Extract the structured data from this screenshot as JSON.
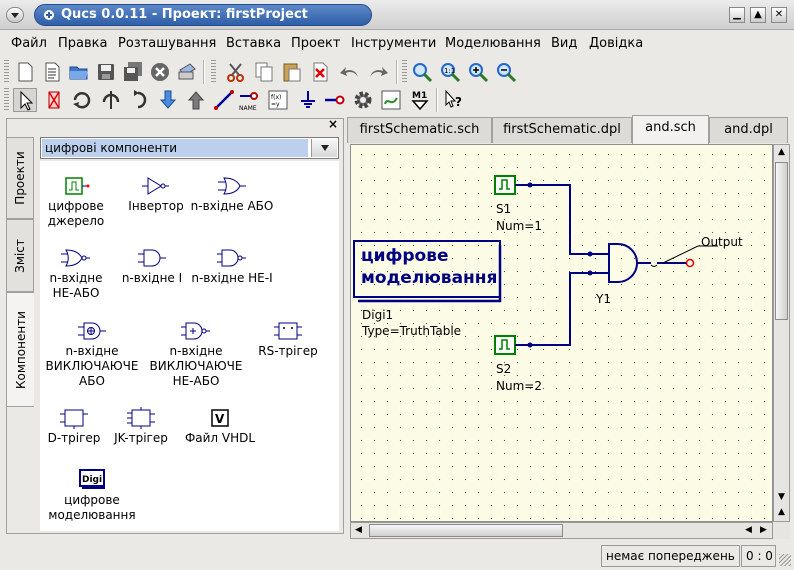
{
  "window": {
    "title": "Qucs 0.0.11 - Проект: firstProject",
    "buttons": {
      "minimize": "▁",
      "maximize": "▲",
      "close": "✕"
    }
  },
  "menu": [
    "Файл",
    "Правка",
    "Розташування",
    "Вставка",
    "Проект",
    "Інструменти",
    "Моделювання",
    "Вид",
    "Довідка"
  ],
  "toolbar": {
    "row1": [
      "new-file-icon",
      "new-text-icon",
      "open-icon",
      "save-icon",
      "save-all-icon",
      "close-doc-icon",
      "print-icon",
      "cut-icon",
      "copy-icon",
      "paste-icon",
      "delete-icon",
      "undo-icon",
      "redo-icon",
      "zoom-fit-icon",
      "zoom-11-icon",
      "zoom-in-icon",
      "zoom-out-icon"
    ],
    "row2": [
      "select-icon",
      "deactivate-icon",
      "rotate-icon",
      "mirror-x-icon",
      "mirror-y-icon",
      "go-into-icon",
      "pop-out-icon",
      "wire-icon",
      "wire-label-icon",
      "equation-icon",
      "ground-icon",
      "port-icon",
      "simulate-icon",
      "view-data-icon",
      "marker-icon",
      "whats-this-icon"
    ],
    "name_label": "NAME",
    "marker_label": "M1"
  },
  "dock": {
    "tabs": [
      "Проекти",
      "Зміст",
      "Компоненти"
    ],
    "active_tab": "Компоненти",
    "close": "×",
    "category": "цифрові компоненти",
    "components": [
      {
        "label": "цифрове\nджерело",
        "icon": "digital-source-icon"
      },
      {
        "label": "Інвертор",
        "icon": "inverter-icon"
      },
      {
        "label": "n-вхідне АБО",
        "icon": "or-gate-icon"
      },
      {
        "label": "n-вхідне\nНЕ-АБО",
        "icon": "nor-gate-icon"
      },
      {
        "label": "n-вхідне І",
        "icon": "and-gate-icon"
      },
      {
        "label": "n-вхідне НЕ-І",
        "icon": "nand-gate-icon"
      },
      {
        "label": "n-вхідне\nВИКЛЮЧАЮЧЕ\nАБО",
        "icon": "xor-gate-icon"
      },
      {
        "label": "n-вхідне\nВИКЛЮЧАЮЧЕ\nНЕ-АБО",
        "icon": "xnor-gate-icon"
      },
      {
        "label": "RS-трігер",
        "icon": "rs-flipflop-icon"
      },
      {
        "label": "D-трігер",
        "icon": "d-flipflop-icon"
      },
      {
        "label": "JK-трігер",
        "icon": "jk-flipflop-icon"
      },
      {
        "label": "Файл VHDL",
        "icon": "vhdl-file-icon"
      },
      {
        "label": "цифрове\nмоделювання",
        "icon": "digital-sim-icon"
      }
    ],
    "vhdl_icon_text": "V",
    "digi_icon_text": "Digi"
  },
  "doc_tabs": [
    "firstSchematic.sch",
    "firstSchematic.dpl",
    "and.sch",
    "and.dpl"
  ],
  "active_doc_tab": "and.sch",
  "schematic": {
    "sim_box_line1": "цифрове",
    "sim_box_line2": "моделювання",
    "sim_name": "Digi1",
    "sim_type": "Type=TruthTable",
    "s1_name": "S1",
    "s1_num": "Num=1",
    "s2_name": "S2",
    "s2_num": "Num=2",
    "gate_name": "Y1",
    "output_label": "Output",
    "colors": {
      "wire": "#000080",
      "source": "#008000",
      "canvas": "#fcfbe6",
      "port": "#ff0000"
    }
  },
  "status": {
    "warnings": "немає попереджень",
    "position": "0 : 0"
  }
}
